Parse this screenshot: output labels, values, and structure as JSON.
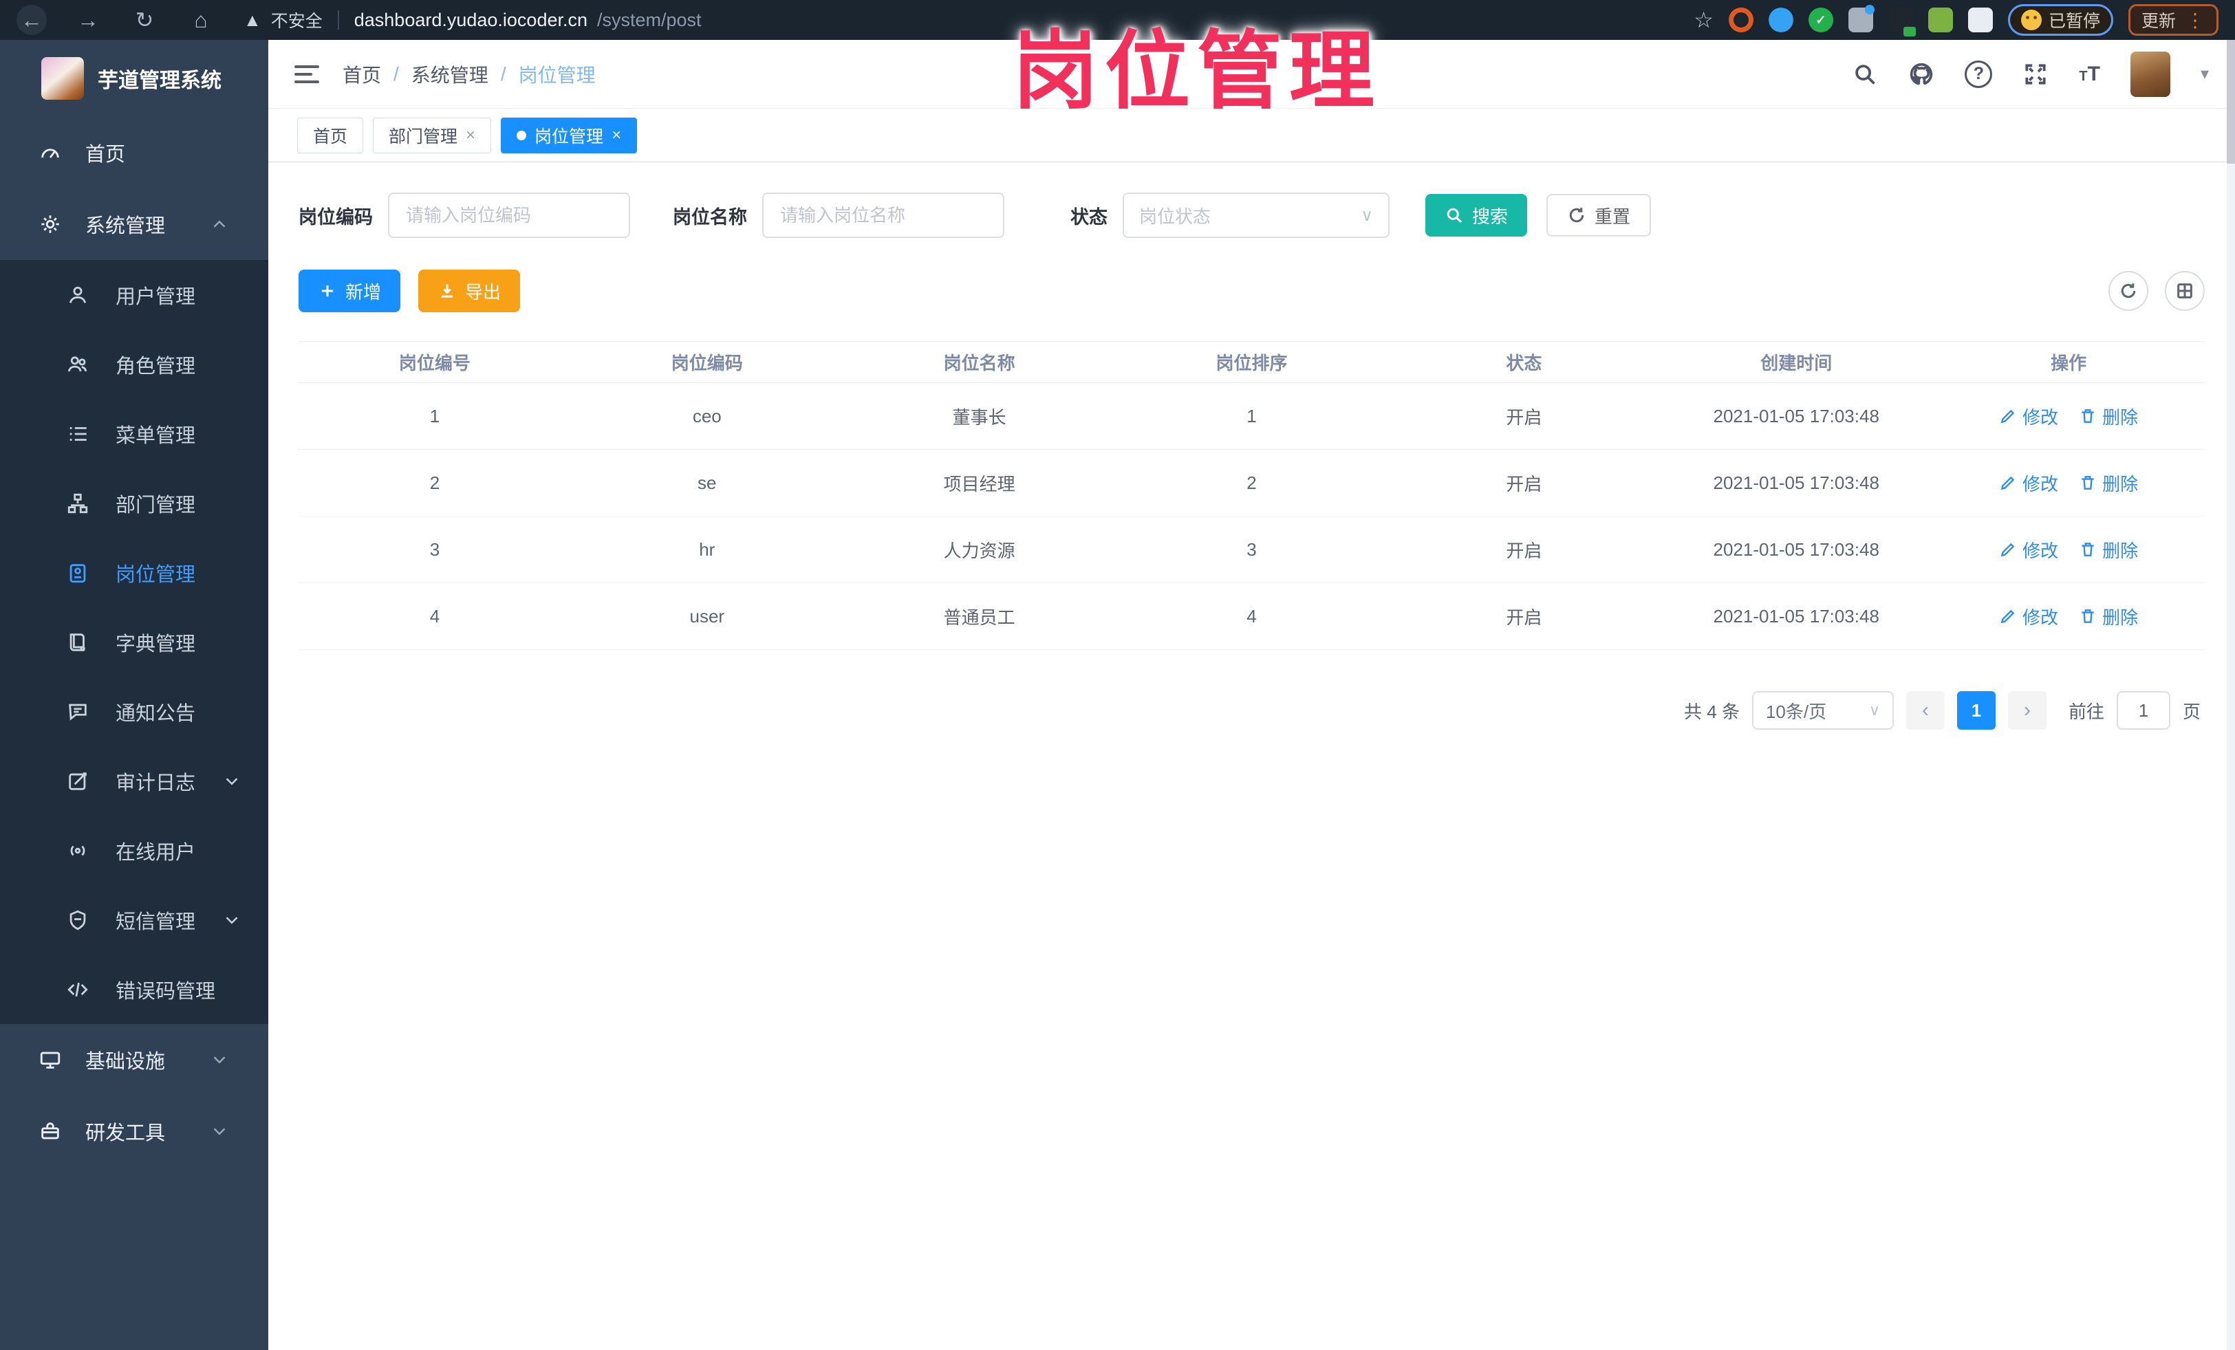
{
  "browser": {
    "security_label": "不安全",
    "url_domain": "dashboard.yudao.iocoder.cn",
    "url_path": "/system/post",
    "paused_badge_label": "已暂停",
    "update_button_label": "更新"
  },
  "annotation_title": "岗位管理",
  "sidebar": {
    "logo_title": "芋道管理系统",
    "items": {
      "home": "首页",
      "system": "系统管理",
      "user": "用户管理",
      "role": "角色管理",
      "menu": "菜单管理",
      "dept": "部门管理",
      "post": "岗位管理",
      "dict": "字典管理",
      "notice": "通知公告",
      "audit": "审计日志",
      "online": "在线用户",
      "sms": "短信管理",
      "errcode": "错误码管理",
      "infra": "基础设施",
      "devtool": "研发工具"
    }
  },
  "breadcrumb": {
    "home": "首页",
    "section": "系统管理",
    "current": "岗位管理"
  },
  "tabs": {
    "home": "首页",
    "dept": "部门管理",
    "post": "岗位管理"
  },
  "filters": {
    "code_label": "岗位编码",
    "code_placeholder": "请输入岗位编码",
    "name_label": "岗位名称",
    "name_placeholder": "请输入岗位名称",
    "status_label": "状态",
    "status_placeholder": "岗位状态",
    "search_label": "搜索",
    "reset_label": "重置"
  },
  "toolbar": {
    "add_label": "新增",
    "export_label": "导出"
  },
  "table": {
    "headers": [
      "岗位编号",
      "岗位编码",
      "岗位名称",
      "岗位排序",
      "状态",
      "创建时间",
      "操作"
    ],
    "edit_label": "修改",
    "delete_label": "删除",
    "rows": [
      {
        "id": "1",
        "code": "ceo",
        "name": "董事长",
        "sort": "1",
        "status": "开启",
        "created": "2021-01-05 17:03:48"
      },
      {
        "id": "2",
        "code": "se",
        "name": "项目经理",
        "sort": "2",
        "status": "开启",
        "created": "2021-01-05 17:03:48"
      },
      {
        "id": "3",
        "code": "hr",
        "name": "人力资源",
        "sort": "3",
        "status": "开启",
        "created": "2021-01-05 17:03:48"
      },
      {
        "id": "4",
        "code": "user",
        "name": "普通员工",
        "sort": "4",
        "status": "开启",
        "created": "2021-01-05 17:03:48"
      }
    ]
  },
  "pagination": {
    "total": "共 4 条",
    "page_size": "10条/页",
    "current_page": "1",
    "goto_label": "前往",
    "goto_value": "1",
    "page_suffix": "页"
  },
  "colors": {
    "accent_blue": "#1890ff",
    "sidebar_active": "#409eff",
    "search_teal": "#17b8a6",
    "export_orange": "#f9a116",
    "annotation_pink": "#f1315c"
  }
}
